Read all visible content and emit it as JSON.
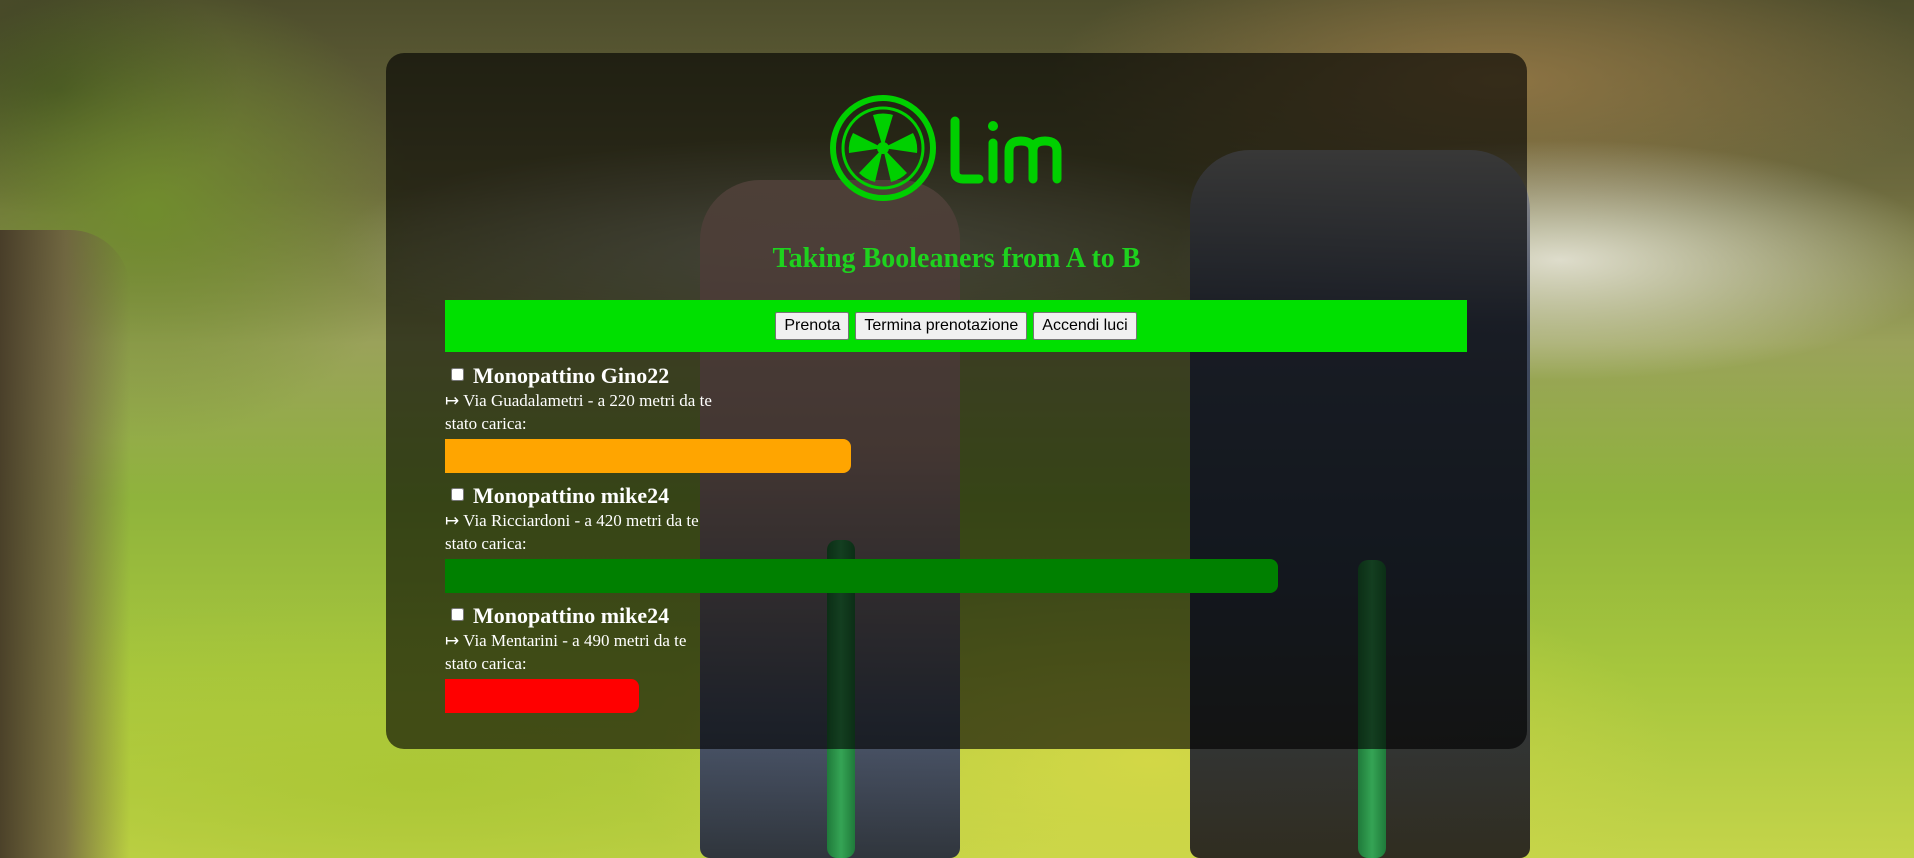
{
  "app": {
    "tagline": "Taking Booleaners from A to B",
    "brand_color": "#00e000",
    "accent_text_color": "#1ed21e"
  },
  "toolbar": {
    "buttons": [
      {
        "label": "Prenota"
      },
      {
        "label": "Termina prenotazione"
      },
      {
        "label": "Accendi luci"
      }
    ]
  },
  "scooters": [
    {
      "name": "Monopattino Gino22",
      "address": "↦ Via Guadalametri - a 220 metri da te",
      "charge_label": "stato carica:",
      "charge_fraction": 0.397,
      "charge_color": "#ffa500",
      "checked": false
    },
    {
      "name": "Monopattino mike24",
      "address": "↦ Via Ricciardoni - a 420 metri da te",
      "charge_label": "stato carica:",
      "charge_fraction": 0.815,
      "charge_color": "#008000",
      "checked": false
    },
    {
      "name": "Monopattino mike24",
      "address": "↦ Via Mentarini - a 490 metri da te",
      "charge_label": "stato carica:",
      "charge_fraction": 0.19,
      "charge_color": "#ff0000",
      "checked": false
    }
  ]
}
